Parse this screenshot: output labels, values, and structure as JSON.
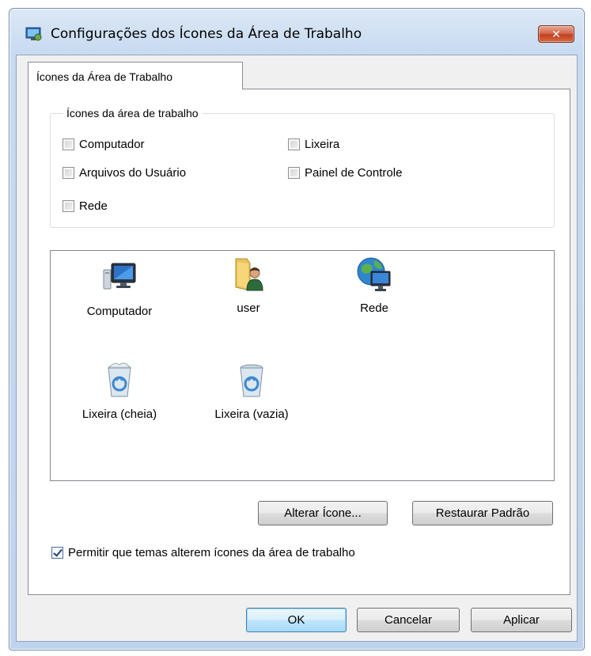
{
  "window": {
    "title": "Configurações dos Ícones da Área de Trabalho",
    "close_label": "✕"
  },
  "tab": {
    "label": "Ícones da Área de Trabalho"
  },
  "group": {
    "legend": "Ícones da área de trabalho",
    "checkboxes": [
      {
        "label": "Computador",
        "checked": false
      },
      {
        "label": "Lixeira",
        "checked": false
      },
      {
        "label": "Arquivos do Usuário",
        "checked": false
      },
      {
        "label": "Painel de Controle",
        "checked": false
      },
      {
        "label": "Rede",
        "checked": false
      }
    ]
  },
  "icons": [
    {
      "label": "Computador",
      "icon": "computer-icon"
    },
    {
      "label": "user",
      "icon": "user-folder-icon"
    },
    {
      "label": "Rede",
      "icon": "network-icon"
    },
    {
      "label": "Lixeira (cheia)",
      "icon": "recycle-bin-full-icon"
    },
    {
      "label": "Lixeira (vazia)",
      "icon": "recycle-bin-empty-icon"
    }
  ],
  "buttons": {
    "change_icon": "Alterar Ícone...",
    "restore_default": "Restaurar Padrão",
    "ok": "OK",
    "cancel": "Cancelar",
    "apply": "Aplicar"
  },
  "allow_themes": {
    "label": "Permitir que temas alterem ícones da área de trabalho",
    "checked": true
  },
  "colors": {
    "title_bar": "#c7daf0",
    "close_button": "#c2401e",
    "default_button": "#3c7fb1"
  }
}
